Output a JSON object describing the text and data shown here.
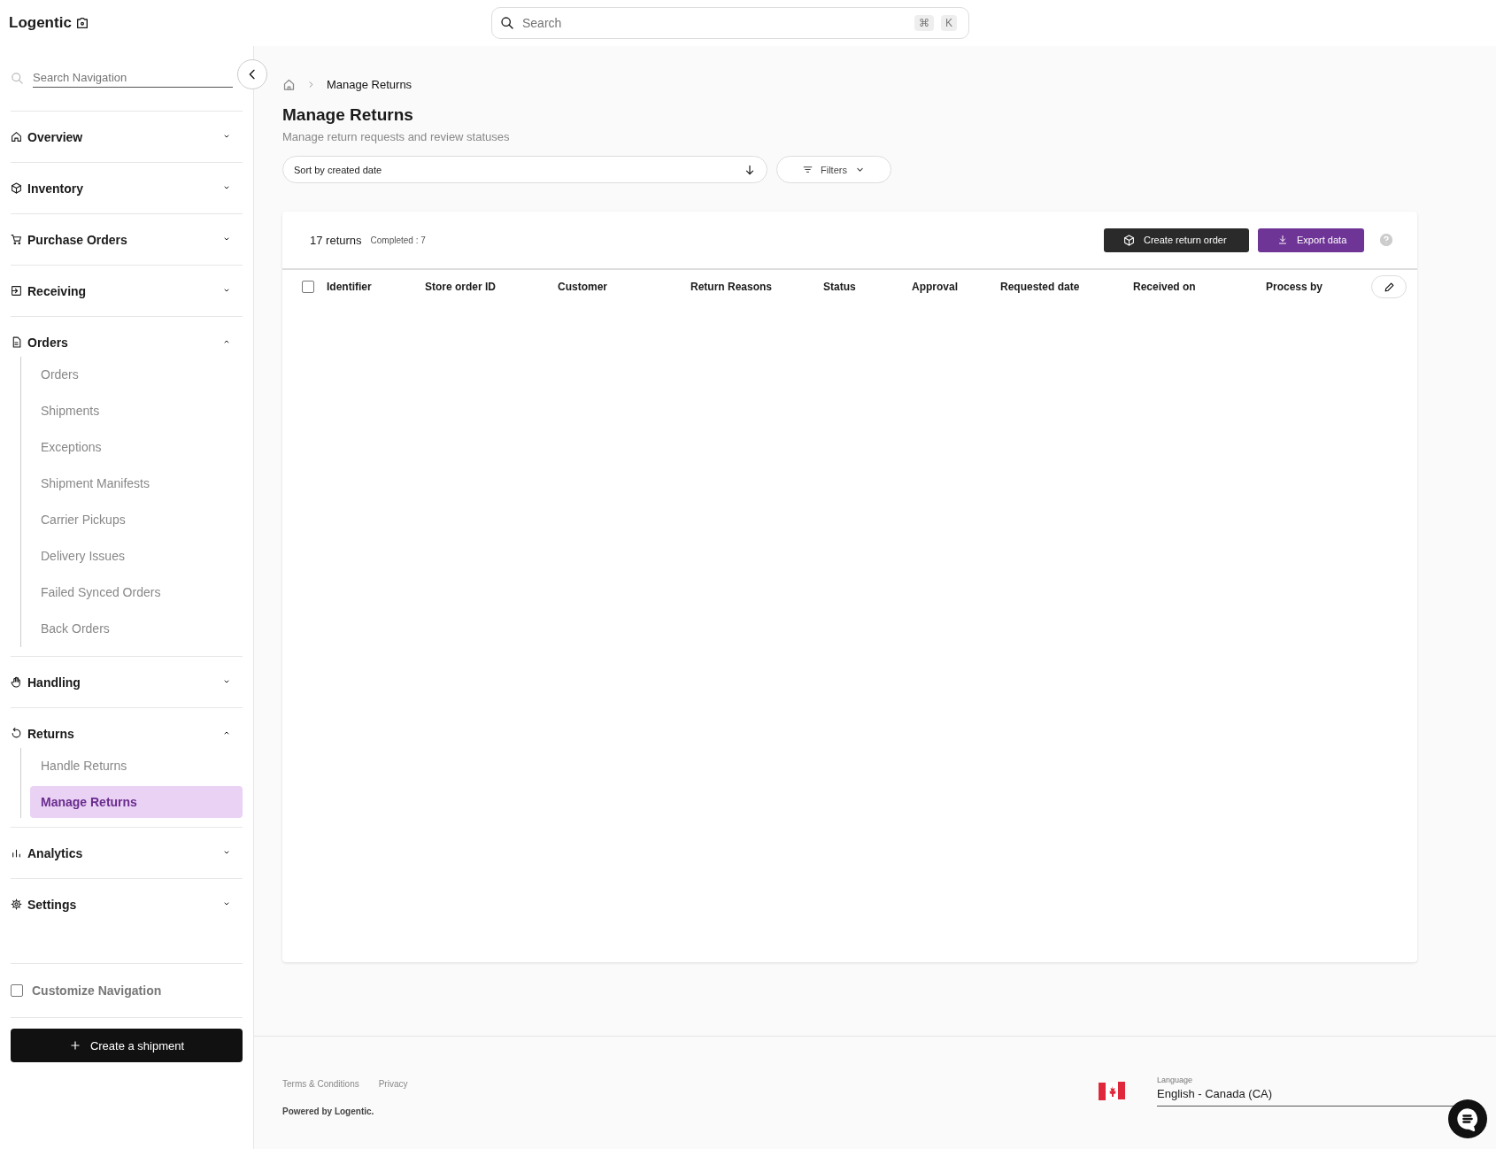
{
  "top_bar": {
    "logo": "Logentic",
    "search": {
      "placeholder": "Search"
    },
    "shortcut_keys": [
      "⌘",
      "K"
    ]
  },
  "sidebar": {
    "search": {
      "placeholder": "Search Navigation"
    },
    "groups": [
      {
        "label": "Overview",
        "expanded": false
      },
      {
        "label": "Inventory",
        "expanded": false
      },
      {
        "label": "Purchase Orders",
        "expanded": false
      },
      {
        "label": "Receiving",
        "expanded": false
      },
      {
        "label": "Orders",
        "expanded": true,
        "children": [
          {
            "label": "Orders",
            "selected": false
          },
          {
            "label": "Shipments",
            "selected": false
          },
          {
            "label": "Exceptions",
            "selected": false
          },
          {
            "label": "Shipment Manifests",
            "selected": false
          },
          {
            "label": "Carrier Pickups",
            "selected": false
          },
          {
            "label": "Delivery Issues",
            "selected": false
          },
          {
            "label": "Failed Synced Orders",
            "selected": false
          },
          {
            "label": "Back Orders",
            "selected": false
          }
        ]
      },
      {
        "label": "Handling",
        "expanded": false
      },
      {
        "label": "Returns",
        "expanded": true,
        "children": [
          {
            "label": "Handle Returns",
            "selected": false
          },
          {
            "label": "Manage Returns",
            "selected": true
          }
        ]
      },
      {
        "label": "Analytics",
        "expanded": false
      },
      {
        "label": "Settings",
        "expanded": false
      }
    ],
    "customize": {
      "label": "Customize Navigation",
      "checked": false
    },
    "create_button": "Create a shipment"
  },
  "breadcrumb": {
    "current": "Manage Returns"
  },
  "page": {
    "title": "Manage Returns",
    "subtitle": "Manage return requests and review statuses"
  },
  "toolbar": {
    "sort": "Sort by created date",
    "filters": "Filters"
  },
  "table": {
    "count": "17 returns",
    "completed": "Completed : 7",
    "create_button": "Create return order",
    "export_button": "Export data",
    "select_all": {
      "checked": false
    },
    "columns": [
      "Identifier",
      "Store order ID",
      "Customer",
      "Return Reasons",
      "Status",
      "Approval",
      "Requested date",
      "Received on",
      "Process by"
    ]
  },
  "footer": {
    "links": [
      "Terms & Conditions",
      "Privacy"
    ],
    "powered_by": "Powered by Logentic.",
    "language": {
      "label": "Language",
      "value": "English - Canada (CA)"
    }
  }
}
